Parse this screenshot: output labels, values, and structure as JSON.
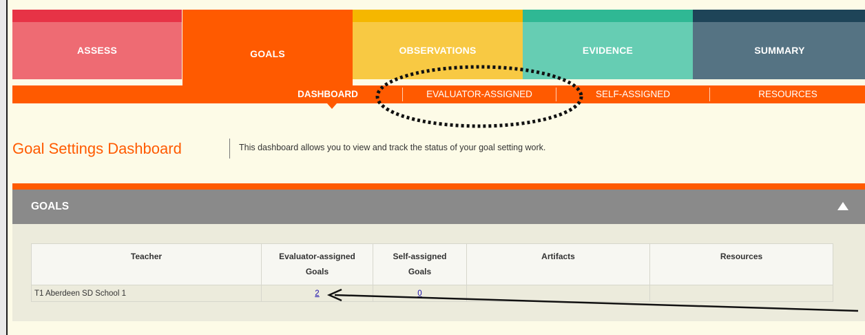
{
  "tabs": [
    "ASSESS",
    "GOALS",
    "OBSERVATIONS",
    "EVIDENCE",
    "SUMMARY"
  ],
  "subnav": [
    "DASHBOARD",
    "EVALUATOR-ASSIGNED",
    "SELF-ASSIGNED",
    "RESOURCES"
  ],
  "page": {
    "title": "Goal Settings Dashboard",
    "description": "This dashboard allows you to view and track the status of your goal setting work."
  },
  "panel": {
    "title": "GOALS"
  },
  "table": {
    "headers": [
      [
        "Teacher"
      ],
      [
        "Evaluator-assigned",
        "Goals"
      ],
      [
        "Self-assigned",
        "Goals"
      ],
      [
        "Artifacts"
      ],
      [
        "Resources"
      ]
    ],
    "row": {
      "teacher": "T1 Aberdeen SD School 1",
      "evaluator_goals": "2",
      "self_goals": "0",
      "artifacts": "",
      "resources": ""
    }
  },
  "colors": {
    "orange": "#ff5a00",
    "assess": "#ee6b73",
    "observations": "#f8c943",
    "evidence": "#66cdb3",
    "summary": "#557383"
  },
  "icons": {
    "collapse": "triangle-up-icon"
  }
}
